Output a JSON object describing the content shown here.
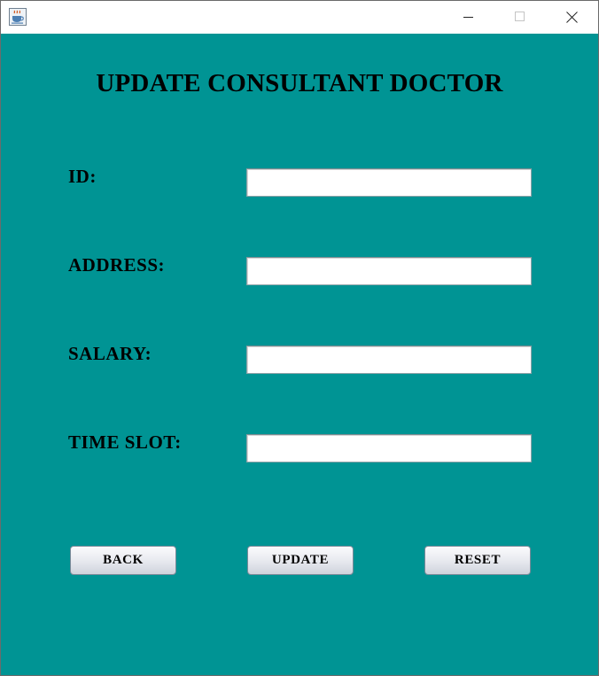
{
  "window": {
    "icons": {
      "app": "java-cup-icon",
      "minimize": "minimize-icon",
      "maximize": "maximize-icon",
      "close": "close-icon"
    }
  },
  "form": {
    "title": "UPDATE CONSULTANT DOCTOR",
    "fields": [
      {
        "label": "ID:",
        "value": ""
      },
      {
        "label": "ADDRESS:",
        "value": ""
      },
      {
        "label": "SALARY:",
        "value": ""
      },
      {
        "label": "TIME SLOT:",
        "value": ""
      }
    ],
    "buttons": {
      "back": "BACK",
      "update": "UPDATE",
      "reset": "RESET"
    }
  },
  "colors": {
    "background": "#009494",
    "titlebar": "#ffffff",
    "field": "#ffffff"
  }
}
